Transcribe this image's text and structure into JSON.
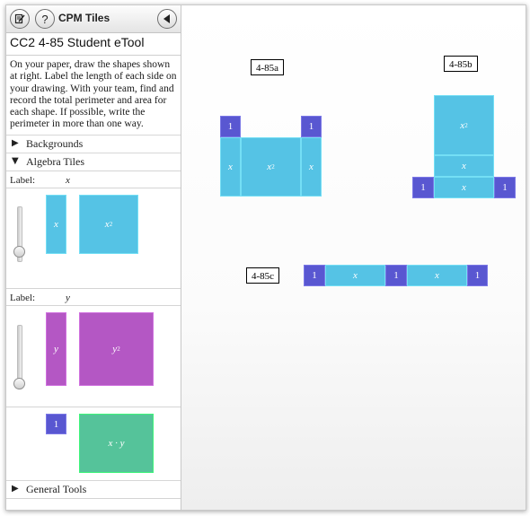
{
  "app": {
    "title": "CPM Tiles",
    "tool_title": "CC2 4-85 Student eTool",
    "instructions": "On your paper, draw the shapes shown at right. Label the length of each side on your drawing. With your team, find and record the total perimeter and area for each shape. If possible, write the perimeter in more than one way."
  },
  "toolbar": {
    "notes_icon": "notepad-icon",
    "help_label": "?",
    "back_icon": "back-arrow-icon"
  },
  "sections": {
    "backgrounds": "Backgrounds",
    "algebra_tiles": "Algebra Tiles",
    "general_tools": "General Tools"
  },
  "tile_groups": [
    {
      "label": "Label:",
      "variable": "x",
      "unit_tile": "x",
      "square_tile": "x",
      "square_exp": "2"
    },
    {
      "label": "Label:",
      "variable": "y",
      "unit_tile": "y",
      "square_tile": "y",
      "square_exp": "2"
    }
  ],
  "mixed_tiles": {
    "one": "1",
    "product": "x · y"
  },
  "problems": [
    {
      "label": "4-85a"
    },
    {
      "label": "4-85b"
    },
    {
      "label": "4-85c"
    }
  ],
  "tile_text": {
    "one": "1",
    "x": "x",
    "x_sq_base": "x",
    "x_sq_exp": "2"
  },
  "colors": {
    "x_tile": "#55c3e5",
    "y_tile": "#b457c4",
    "unit_tile": "#5957d1",
    "xy_tile": "#55c39a"
  }
}
